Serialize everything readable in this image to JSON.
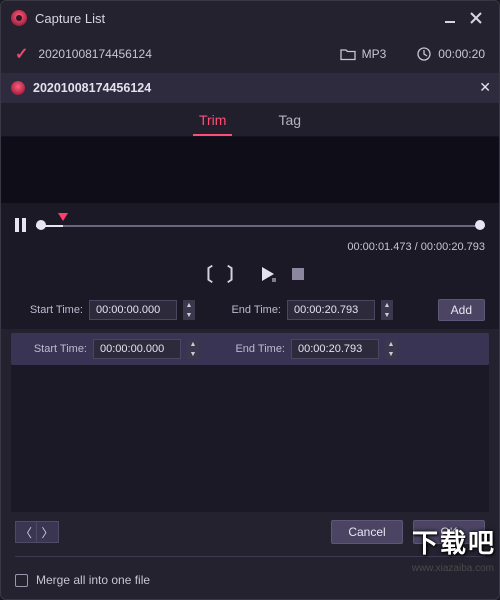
{
  "window": {
    "title": "Capture List"
  },
  "info": {
    "id": "20201008174456124",
    "format": "MP3",
    "duration": "00:00:20"
  },
  "subheader": {
    "title": "20201008174456124"
  },
  "tabs": {
    "trim": "Trim",
    "tag": "Tag",
    "active": "trim"
  },
  "player": {
    "position": "00:00:01.473",
    "total": "00:00:20.793"
  },
  "times_primary": {
    "start_label": "Start Time:",
    "start_value": "00:00:00.000",
    "end_label": "End Time:",
    "end_value": "00:00:20.793",
    "add_label": "Add"
  },
  "times_segment": {
    "start_label": "Start Time:",
    "start_value": "00:00:00.000",
    "end_label": "End Time:",
    "end_value": "00:00:20.793"
  },
  "buttons": {
    "cancel": "Cancel",
    "ok": "OK"
  },
  "footer": {
    "merge_label": "Merge all into one file"
  },
  "watermark": {
    "big": "下载吧",
    "url": "www.xiazaiba.com"
  },
  "colors": {
    "accent": "#ff4e75",
    "bg": "#24222f",
    "panel": "#1b1926"
  }
}
